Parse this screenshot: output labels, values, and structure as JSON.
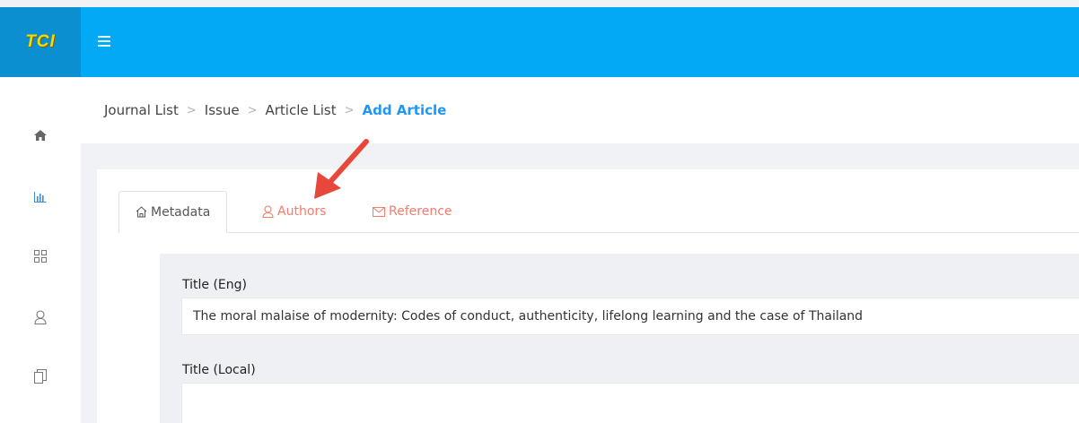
{
  "app": {
    "logo_text": "TCI"
  },
  "sidebar": {
    "items": [
      {
        "icon": "home-icon"
      },
      {
        "icon": "bar-chart-icon"
      },
      {
        "icon": "grid-icon"
      },
      {
        "icon": "user-icon"
      },
      {
        "icon": "documents-icon"
      }
    ]
  },
  "breadcrumb": {
    "items": [
      "Journal List",
      "Issue",
      "Article List"
    ],
    "current": "Add Article"
  },
  "tabs": [
    {
      "label": "Metadata",
      "icon": "home-outline-icon",
      "active": true
    },
    {
      "label": "Authors",
      "icon": "user-outline-icon",
      "active": false
    },
    {
      "label": "Reference",
      "icon": "envelope-icon",
      "active": false
    }
  ],
  "form": {
    "title_eng": {
      "label": "Title (Eng)",
      "value": "The moral malaise of modernity: Codes of conduct, authenticity, lifelong learning and the case of Thailand"
    },
    "title_local": {
      "label": "Title (Local)",
      "value": ""
    }
  },
  "colors": {
    "topbar": "#03a9f4",
    "logo_bg": "#0b8fd0",
    "logo_text": "#f7d900",
    "breadcrumb_active": "#2196f3",
    "tab_inactive": "#f77a6a",
    "annotation_arrow": "#e8473b"
  }
}
